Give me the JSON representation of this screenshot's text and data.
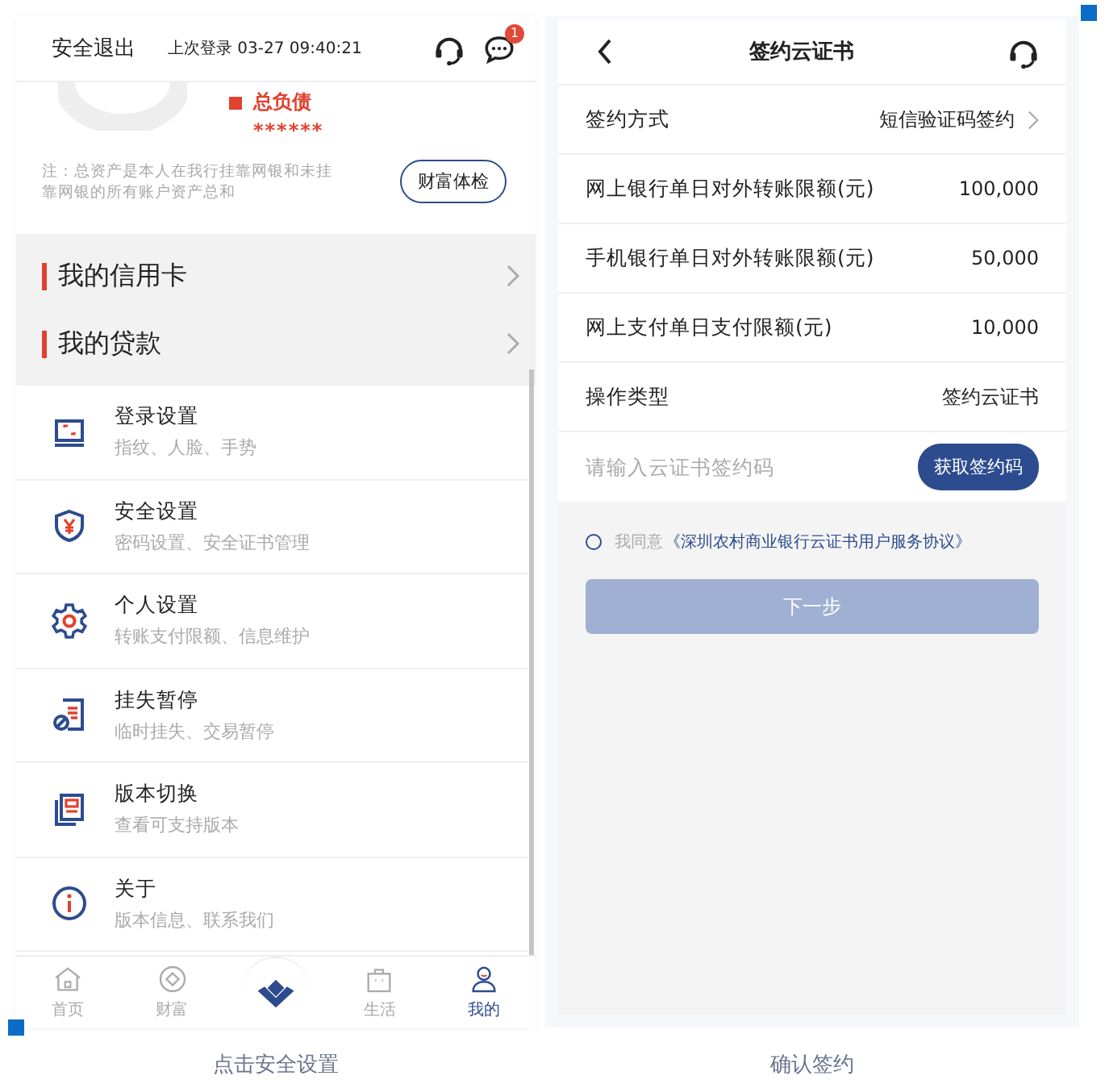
{
  "left_screen": {
    "header": {
      "logout": "安全退出",
      "last_login": "上次登录 03-27 09:40:21",
      "message_badge": "1"
    },
    "summary": {
      "legend": "总负债",
      "amount": "******",
      "note": "注：总资产是本人在我行挂靠网银和未挂靠网银的所有账户资产总和",
      "button": "财富体检"
    },
    "sections": [
      {
        "label": "我的信用卡"
      },
      {
        "label": "我的贷款"
      }
    ],
    "menu": [
      {
        "kind": "login",
        "title": "登录设置",
        "subtitle": "指纹、人脸、手势"
      },
      {
        "kind": "security",
        "title": "安全设置",
        "subtitle": "密码设置、安全证书管理"
      },
      {
        "kind": "personal",
        "title": "个人设置",
        "subtitle": "转账支付限额、信息维护"
      },
      {
        "kind": "loss",
        "title": "挂失暂停",
        "subtitle": "临时挂失、交易暂停"
      },
      {
        "kind": "version",
        "title": "版本切换",
        "subtitle": "查看可支持版本"
      },
      {
        "kind": "about",
        "title": "关于",
        "subtitle": "版本信息、联系我们"
      }
    ],
    "tabs": [
      {
        "kind": "home",
        "label": "首页",
        "selected": false
      },
      {
        "kind": "wealth",
        "label": "财富",
        "selected": false
      },
      {
        "kind": "center"
      },
      {
        "kind": "life",
        "label": "生活",
        "selected": false
      },
      {
        "kind": "mine",
        "label": "我的",
        "selected": true
      }
    ],
    "caption": "点击安全设置"
  },
  "right_screen": {
    "title": "签约云证书",
    "rows": [
      {
        "label": "签约方式",
        "value": "短信验证码签约",
        "chevron": true
      },
      {
        "label": "网上银行单日对外转账限额(元)",
        "value": "100,000",
        "chevron": false
      },
      {
        "label": "手机银行单日对外转账限额(元)",
        "value": "50,000",
        "chevron": false
      },
      {
        "label": "网上支付单日支付限额(元)",
        "value": "10,000",
        "chevron": false
      },
      {
        "label": "操作类型",
        "value": "签约云证书",
        "chevron": false
      }
    ],
    "code_field": {
      "placeholder": "请输入云证书签约码",
      "button": "获取签约码"
    },
    "agreement": {
      "checked": false,
      "prefix": "我同意",
      "link": "《深圳农村商业银行云证书用户服务协议》"
    },
    "next_button": {
      "label": "下一步",
      "disabled": true
    },
    "caption": "确认签约"
  }
}
